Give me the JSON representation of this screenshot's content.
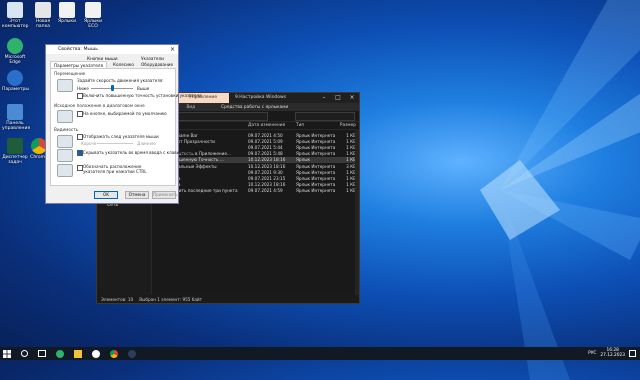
{
  "explorer": {
    "tab_manage": "Управление",
    "title": "9.Настройка Windows",
    "ribbon": [
      "Файл",
      "Главная",
      "Поделиться",
      "Вид"
    ],
    "ribbon_sub": "Средства работы с ярлыками",
    "address": "9.Настройка Windows",
    "nav_network": "Сеть",
    "columns": [
      "",
      "Дата изменения",
      "Тип",
      "Размер"
    ],
    "rows": [
      [
        "ить Xbox Game Bar",
        "09.07.2021 4:50",
        "Ярлык Интернета",
        "1 КБ"
      ],
      [
        "ить Эффект Прозрачности",
        "09.07.2021 5:09",
        "Ярлык Интернета",
        "1 КБ"
      ],
      [
        "Рисунов",
        "09.07.2021 5:44",
        "Ярлык Интернета",
        "1 КБ"
      ],
      [
        "нить Размытость в Приложение...",
        "09.07.2021 5:48",
        "Ярлык Интернета",
        "1 КБ"
      ],
      [
        "нить Повышенную Точность ...",
        "10.12.2023 18:16",
        "Ярлык",
        "1 КБ"
      ],
      [
        "нить Визуальные Эффекты",
        "10.12.2023 18:16",
        "Ярлык Интернета",
        "3 КБ"
      ],
      [
        "Питание",
        "09.07.2021 9:30",
        "Ярлык Интернета",
        "1 КБ"
      ],
      [
        "ибок Звука",
        "09.07.2021 23:15",
        "Ярлык Интернета",
        "1 КБ"
      ],
      [
        "ибок Звука",
        "10.12.2023 18:16",
        "Ярлык Интернета",
        "1 КБ"
      ],
      [
        "Восстановить последние три пункта",
        "09.07.2021 4:59",
        "Ярлык Интернета",
        "1 КБ"
      ]
    ],
    "status_count": "Элементов: 10",
    "status_selected": "Выбран 1 элемент: 955 байт"
  },
  "dialog": {
    "title": "Свойства: Мышь",
    "tabs": [
      "Кнопки мыши",
      "Указатели",
      "Параметры указателя",
      "Колесико",
      "Оборудование"
    ],
    "group_move": "Перемещение",
    "speed_label": "Задайте скорость движения указателя:",
    "speed_low": "Ниже",
    "speed_high": "Выше",
    "speed_value": 0.5,
    "precision_label": "Включить повышенную точность установки указателя",
    "group_snap": "Исходное положение в диалоговом окне",
    "snap_label": "На кнопке, выбираемой по умолчанию",
    "group_vis": "Видимость",
    "trail_label": "Отображать след указателя мыши",
    "trail_short": "Короче",
    "trail_long": "Длиннее",
    "hide_label": "Скрывать указатель во время ввода с клавиатуры",
    "ctrl_label": "Обозначать расположение указателя при нажатии CTRL",
    "ok": "OK",
    "cancel": "Отмена",
    "apply": "Применить"
  },
  "desktop_icons": [
    "Этот компьютер",
    "Новая папка",
    "Ярлыки",
    "Ярлыки ЕСО",
    "Microsoft Edge",
    "Параметры",
    "Панель управления",
    "Диспетчер задач",
    "Chrome"
  ],
  "taskbar": {
    "lang": "РУС",
    "time": "16:28",
    "date": "27.12.2023"
  }
}
